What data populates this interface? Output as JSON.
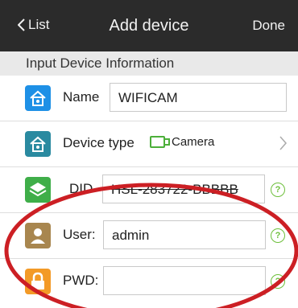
{
  "header": {
    "back_label": "List",
    "title": "Add device",
    "done_label": "Done"
  },
  "section": {
    "title": "Input Device Information"
  },
  "form": {
    "name": {
      "label": "Name",
      "value": "WIFICAM",
      "icon": "home-icon"
    },
    "device_type": {
      "label": "Device type",
      "value": "Camera",
      "icon": "home-icon"
    },
    "did": {
      "label": "DID",
      "value": "HSL-283722-BBBBB",
      "icon": "layers-icon"
    },
    "user": {
      "label": "User:",
      "value": "admin",
      "icon": "user-icon"
    },
    "pwd": {
      "label": "PWD:",
      "value": "",
      "icon": "lock-icon"
    }
  },
  "help_symbol": "?",
  "colors": {
    "header_bg": "#2b2b2b",
    "section_bg": "#e9e9e9",
    "name_icon": "#1e90e6",
    "device_type_icon": "#2a8aa0",
    "did_icon": "#3fae49",
    "user_icon": "#a8864f",
    "pwd_icon": "#f39a27",
    "help_green": "#6dbf3b",
    "annotation_red": "#cc1f24"
  }
}
